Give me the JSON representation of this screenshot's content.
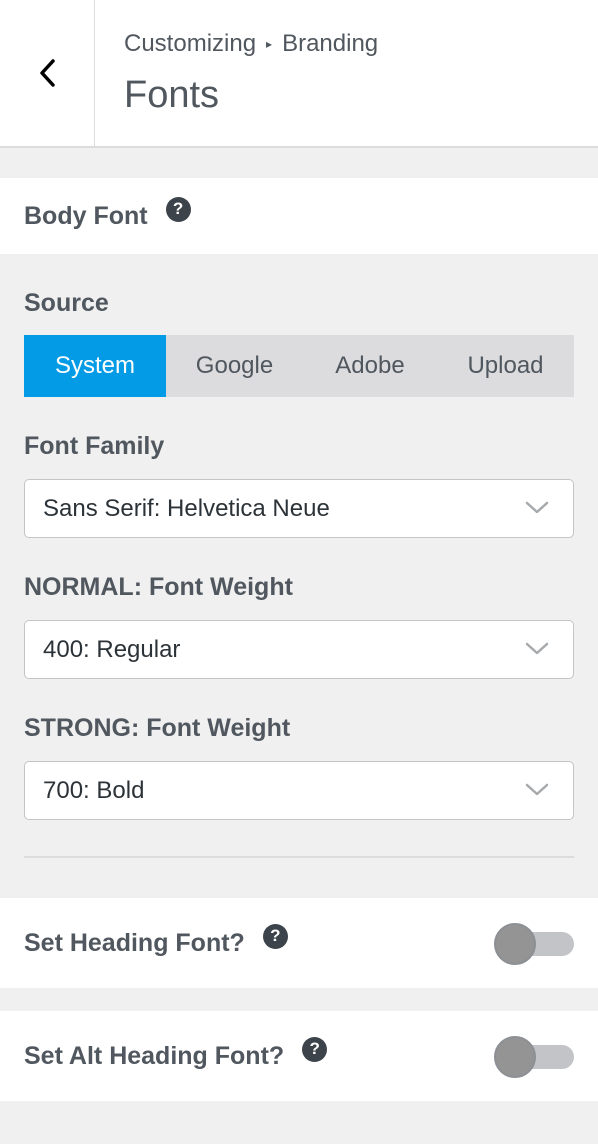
{
  "header": {
    "breadcrumb_parent": "Customizing",
    "breadcrumb_separator": "▸",
    "breadcrumb_current": "Branding",
    "title": "Fonts"
  },
  "body_font": {
    "label": "Body Font",
    "help": "?"
  },
  "source": {
    "label": "Source",
    "options": [
      "System",
      "Google",
      "Adobe",
      "Upload"
    ],
    "selected": "System"
  },
  "font_family": {
    "label": "Font Family",
    "value": "Sans Serif: Helvetica Neue"
  },
  "normal_weight": {
    "label": "NORMAL: Font Weight",
    "value": "400: Regular"
  },
  "strong_weight": {
    "label": "STRONG: Font Weight",
    "value": "700: Bold"
  },
  "heading_font": {
    "label": "Set Heading Font?",
    "help": "?",
    "enabled": false
  },
  "alt_heading_font": {
    "label": "Set Alt Heading Font?",
    "help": "?",
    "enabled": false
  },
  "colors": {
    "accent": "#039be5",
    "text": "#50575e",
    "panel_bg": "#f0f0f1"
  }
}
